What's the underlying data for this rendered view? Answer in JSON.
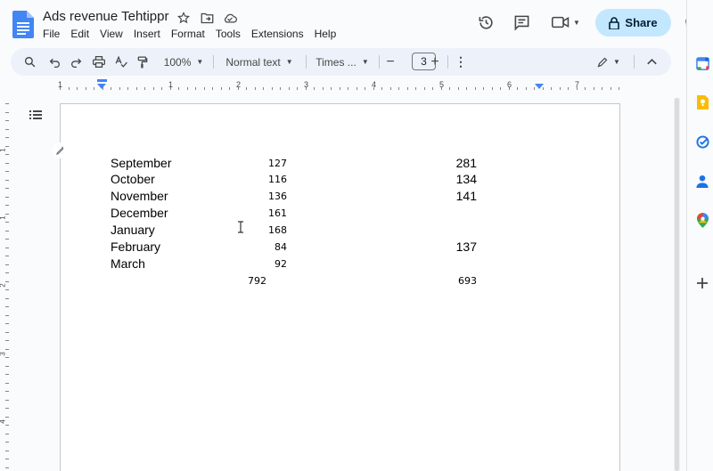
{
  "document": {
    "title": "Ads revenue Tehtippr"
  },
  "menu": [
    "File",
    "Edit",
    "View",
    "Insert",
    "Format",
    "Tools",
    "Extensions",
    "Help"
  ],
  "share": {
    "label": "Share"
  },
  "toolbar": {
    "zoom": "100%",
    "style": "Normal text",
    "font": "Times ...",
    "font_size": "3"
  },
  "ruler": {
    "numbers": [
      "1",
      "1",
      "2",
      "3",
      "4",
      "5",
      "6",
      "7"
    ]
  },
  "vruler": {
    "numbers": [
      "1",
      "1",
      "2",
      "3",
      "4"
    ]
  },
  "table": {
    "rows": [
      {
        "month": "September",
        "v1": "127",
        "v2": "281"
      },
      {
        "month": "October",
        "v1": "116",
        "v2": "134"
      },
      {
        "month": "November",
        "v1": "136",
        "v2": "141"
      },
      {
        "month": "December",
        "v1": "161",
        "v2": ""
      },
      {
        "month": "January",
        "v1": "168",
        "v2": ""
      },
      {
        "month": "February",
        "v1": "84",
        "v2": "137"
      },
      {
        "month": "March",
        "v1": "92",
        "v2": ""
      }
    ],
    "totals": {
      "t1": "792",
      "t2": "693"
    }
  },
  "side_apps": [
    "calendar-icon",
    "keep-icon",
    "tasks-icon",
    "contacts-icon",
    "maps-icon",
    "add-icon"
  ],
  "colors": {
    "accent": "#1a73e8",
    "share_bg": "#c2e7ff",
    "toolbar_bg": "#edf2fa"
  }
}
